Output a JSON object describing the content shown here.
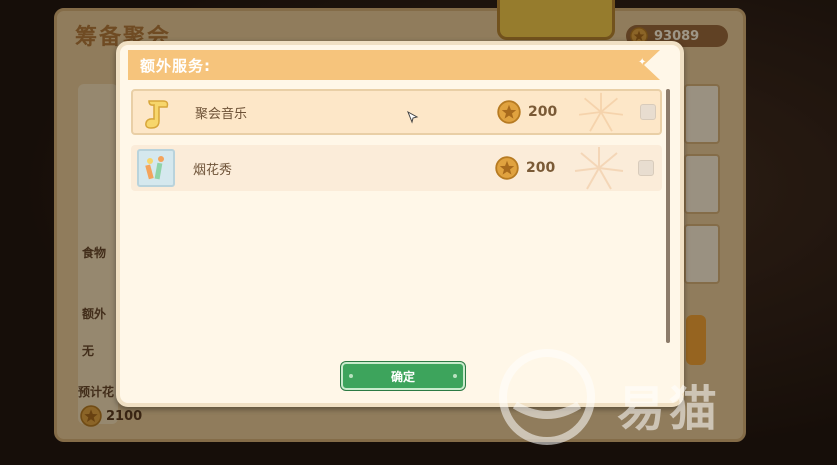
{
  "background": {
    "panel_title": "筹备聚会",
    "coin_balance": "93089",
    "food_label": "食物",
    "extra_label": "额外",
    "none_value": "无",
    "estimate_label": "预计花",
    "estimate_cost": "2100"
  },
  "modal": {
    "title": "额外服务:",
    "items": [
      {
        "label": "聚会音乐",
        "price": "200",
        "icon": "music-note-icon",
        "selected": true
      },
      {
        "label": "烟花秀",
        "price": "200",
        "icon": "fireworks-icon",
        "selected": false
      }
    ],
    "confirm_label": "确定"
  },
  "watermark": {
    "text": "易猫"
  },
  "colors": {
    "header": "#f6c47c",
    "confirm": "#3da45c",
    "coin": "#e0a23f",
    "panel": "#fff7e8"
  }
}
